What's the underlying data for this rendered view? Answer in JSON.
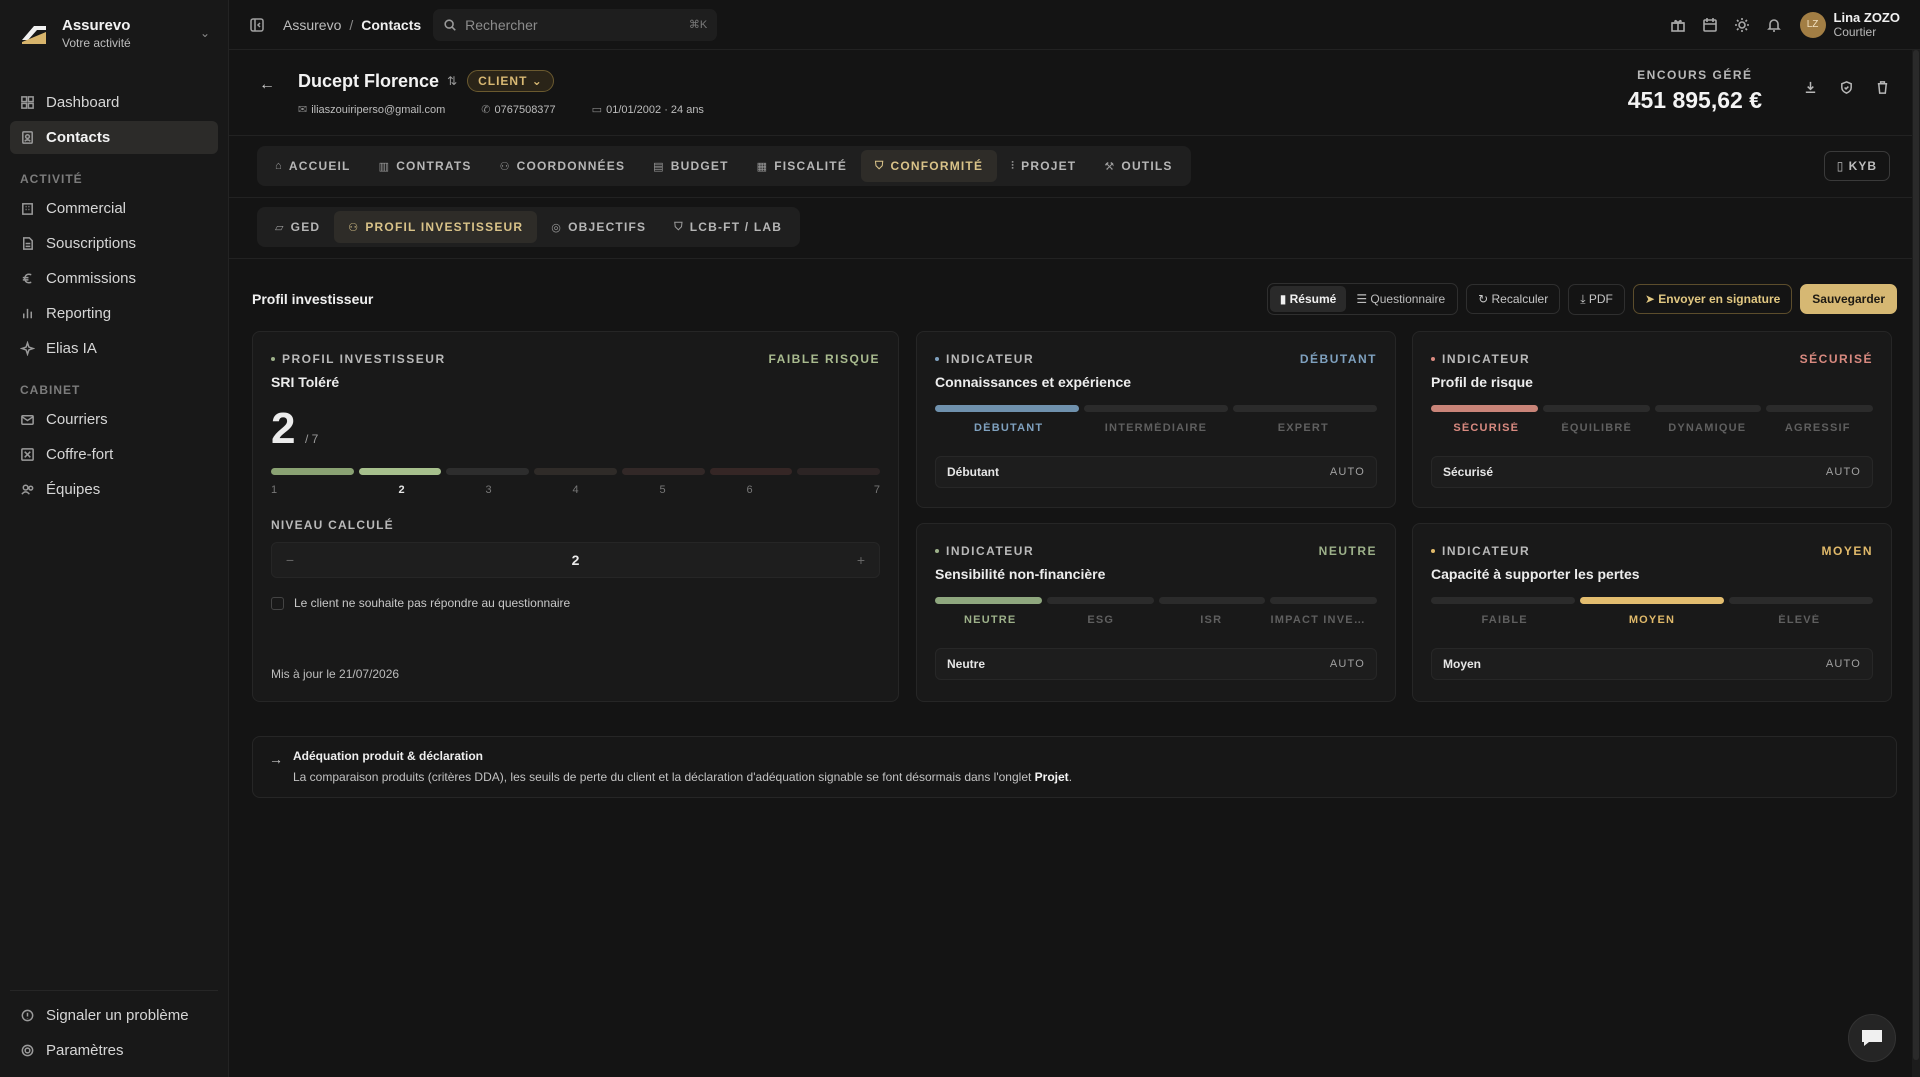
{
  "brand": {
    "name": "Assurevo",
    "subtitle": "Votre activité"
  },
  "sidebar": {
    "items": [
      {
        "label": "Dashboard",
        "icon": "dashboard-icon",
        "active": false
      },
      {
        "label": "Contacts",
        "icon": "contacts-icon",
        "active": true
      }
    ],
    "section_activite": "ACTIVITÉ",
    "activite_items": [
      {
        "label": "Commercial",
        "icon": "building-icon"
      },
      {
        "label": "Souscriptions",
        "icon": "file-icon"
      },
      {
        "label": "Commissions",
        "icon": "euro-icon"
      },
      {
        "label": "Reporting",
        "icon": "chart-icon"
      },
      {
        "label": "Elias IA",
        "icon": "sparkle-icon"
      }
    ],
    "section_cabinet": "CABINET",
    "cabinet_items": [
      {
        "label": "Courriers",
        "icon": "mail-icon"
      },
      {
        "label": "Coffre-fort",
        "icon": "vault-icon"
      },
      {
        "label": "Équipes",
        "icon": "users-icon"
      }
    ],
    "bottom_items": [
      {
        "label": "Signaler un problème",
        "icon": "bug-icon"
      },
      {
        "label": "Paramètres",
        "icon": "gear-icon"
      }
    ]
  },
  "topbar": {
    "breadcrumb_root": "Assurevo",
    "breadcrumb_sep": "/",
    "breadcrumb_current": "Contacts",
    "search_placeholder": "Rechercher",
    "search_shortcut": "⌘K",
    "user_initials": "LZ",
    "user_name": "Lina ZOZO",
    "user_role": "Courtier"
  },
  "contact": {
    "name": "Ducept Florence",
    "badge": "CLIENT",
    "email": "iliaszouiriperso@gmail.com",
    "phone": "0767508377",
    "birth": "01/01/2002 · 24 ans",
    "encours_label": "ENCOURS GÉRÉ",
    "encours_value": "451 895,62 €"
  },
  "tabs": [
    "ACCUEIL",
    "CONTRATS",
    "COORDONNÉES",
    "BUDGET",
    "FISCALITÉ",
    "CONFORMITÉ",
    "PROJET",
    "OUTILS"
  ],
  "tabs_active_index": 5,
  "kyb_label": "KYB",
  "subtabs": [
    "GED",
    "PROFIL INVESTISSEUR",
    "OBJECTIFS",
    "LCB-FT / LAB"
  ],
  "subtabs_active_index": 1,
  "section": {
    "title": "Profil investisseur",
    "seg_resume": "Résumé",
    "seg_questionnaire": "Questionnaire",
    "btn_recalculer": "Recalculer",
    "btn_pdf": "PDF",
    "btn_signature": "Envoyer en signature",
    "btn_save": "Sauvegarder"
  },
  "profile_card": {
    "kicker": "PROFIL INVESTISSEUR",
    "tag": "FAIBLE RISQUE",
    "title": "SRI Toléré",
    "sri_value": "2",
    "sri_max": "/ 7",
    "sri_level": 2,
    "scale": [
      "1",
      "2",
      "3",
      "4",
      "5",
      "6",
      "7"
    ],
    "calc_label": "NIVEAU CALCULÉ",
    "calc_value": "2",
    "minus": "−",
    "plus": "+",
    "checkbox_label": "Le client ne souhaite pas répondre au questionnaire",
    "updated": "Mis à jour le 21/07/2026"
  },
  "indicators": {
    "connaissances": {
      "kicker": "INDICATEUR",
      "tag": "DÉBUTANT",
      "tag_color": "#7fa1bf",
      "title": "Connaissances et expérience",
      "levels": [
        "DÉBUTANT",
        "INTERMÉDIAIRE",
        "EXPERT"
      ],
      "active_index": 0,
      "value": "Débutant",
      "mode": "AUTO",
      "bar_color": "#6f91ad"
    },
    "risque": {
      "kicker": "INDICATEUR",
      "tag": "SÉCURISÉ",
      "tag_color": "#d98a80",
      "title": "Profil de risque",
      "levels": [
        "SÉCURISÉ",
        "ÉQUILIBRÉ",
        "DYNAMIQUE",
        "AGRESSIF"
      ],
      "active_index": 0,
      "value": "Sécurisé",
      "mode": "AUTO",
      "bar_color": "#c98478"
    },
    "sensibilite": {
      "kicker": "INDICATEUR",
      "tag": "NEUTRE",
      "tag_color": "#9db18a",
      "title": "Sensibilité non-financière",
      "levels": [
        "NEUTRE",
        "ESG",
        "ISR",
        "IMPACT INVESTISSEMENT"
      ],
      "active_index": 0,
      "value": "Neutre",
      "mode": "AUTO",
      "bar_color": "#8fa77e"
    },
    "pertes": {
      "kicker": "INDICATEUR",
      "tag": "MOYEN",
      "tag_color": "#e0b96a",
      "title": "Capacité à supporter les pertes",
      "levels": [
        "FAIBLE",
        "MOYEN",
        "ÉLEVÉ"
      ],
      "active_index": 1,
      "value": "Moyen",
      "mode": "AUTO",
      "bar_color": "#e3bd6f"
    }
  },
  "note": {
    "title": "Adéquation produit & déclaration",
    "body_prefix": "La comparaison produits (critères DDA), les seuils de perte du client et la déclaration d'adéquation signable se font désormais dans l'onglet ",
    "body_bold": "Projet",
    "body_suffix": "."
  },
  "colors": {
    "accent_gold": "#d6b873",
    "background": "#141414",
    "card": "#191919"
  }
}
